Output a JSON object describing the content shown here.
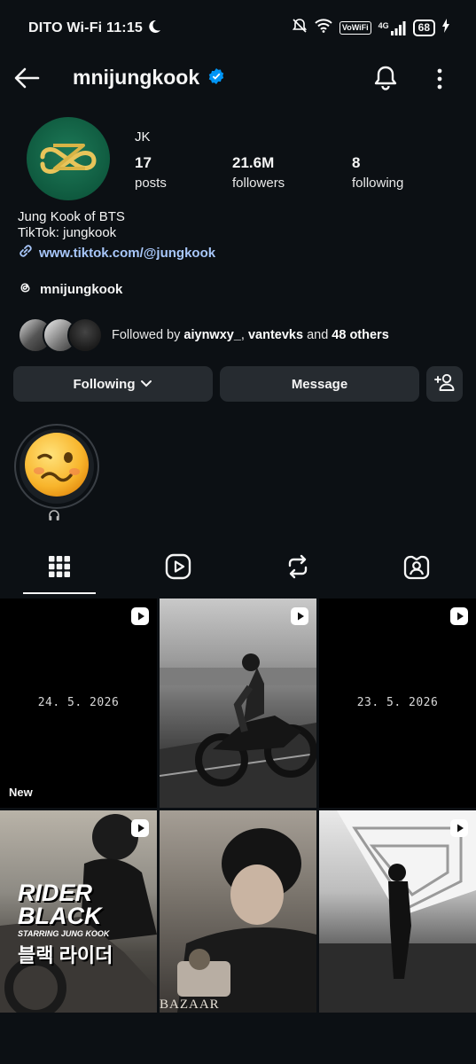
{
  "status_bar": {
    "carrier": "DITO Wi-Fi",
    "time": "11:15",
    "volte": "VoWiFi",
    "network": "4G",
    "battery": "68"
  },
  "header": {
    "username": "mnijungkook",
    "verified_icon": "verified-badge-icon",
    "back_icon": "back-arrow-icon",
    "bell_icon": "bell-icon",
    "more_icon": "more-vertical-icon"
  },
  "profile": {
    "full_name": "JK",
    "stats": [
      {
        "value": "17",
        "label": "posts"
      },
      {
        "value": "21.6M",
        "label": "followers"
      },
      {
        "value": "8",
        "label": "following"
      }
    ],
    "bio_lines": [
      "Jung Kook of BTS",
      "TikTok: jungkook"
    ],
    "link": "www.tiktok.com/@jungkook",
    "threads_handle": "mnijungkook",
    "followed_by": {
      "prefix": "Followed by ",
      "user1": "aiynwxy_",
      "sep": ", ",
      "user2": "vantevks",
      "and": " and ",
      "others": "48 others"
    }
  },
  "actions": {
    "following_label": "Following",
    "message_label": "Message"
  },
  "highlight": {
    "icon": "headphones-icon"
  },
  "tabs": [
    {
      "name": "posts-grid-tab",
      "icon": "grid-icon",
      "active": true
    },
    {
      "name": "reels-tab",
      "icon": "reels-icon",
      "active": false
    },
    {
      "name": "reposts-tab",
      "icon": "repost-icon",
      "active": false
    },
    {
      "name": "tagged-tab",
      "icon": "tagged-icon",
      "active": false
    }
  ],
  "posts": [
    {
      "caption": "24. 5. 2026",
      "tag": "New"
    },
    {
      "caption": "",
      "tag": ""
    },
    {
      "caption": "23. 5. 2026",
      "tag": ""
    },
    {
      "caption": "",
      "tag": "",
      "overlay_title": "RIDER BLACK",
      "overlay_sub": "STARRING JUNG KOOK",
      "overlay_korean": "블랙 라이더"
    },
    {
      "caption": "",
      "tag": "",
      "watermark": "BAZAAR"
    },
    {
      "caption": "",
      "tag": ""
    }
  ],
  "colors": {
    "background": "#0c1014",
    "button": "#262b30",
    "link": "#a8c7fa",
    "verified": "#0095f6"
  }
}
